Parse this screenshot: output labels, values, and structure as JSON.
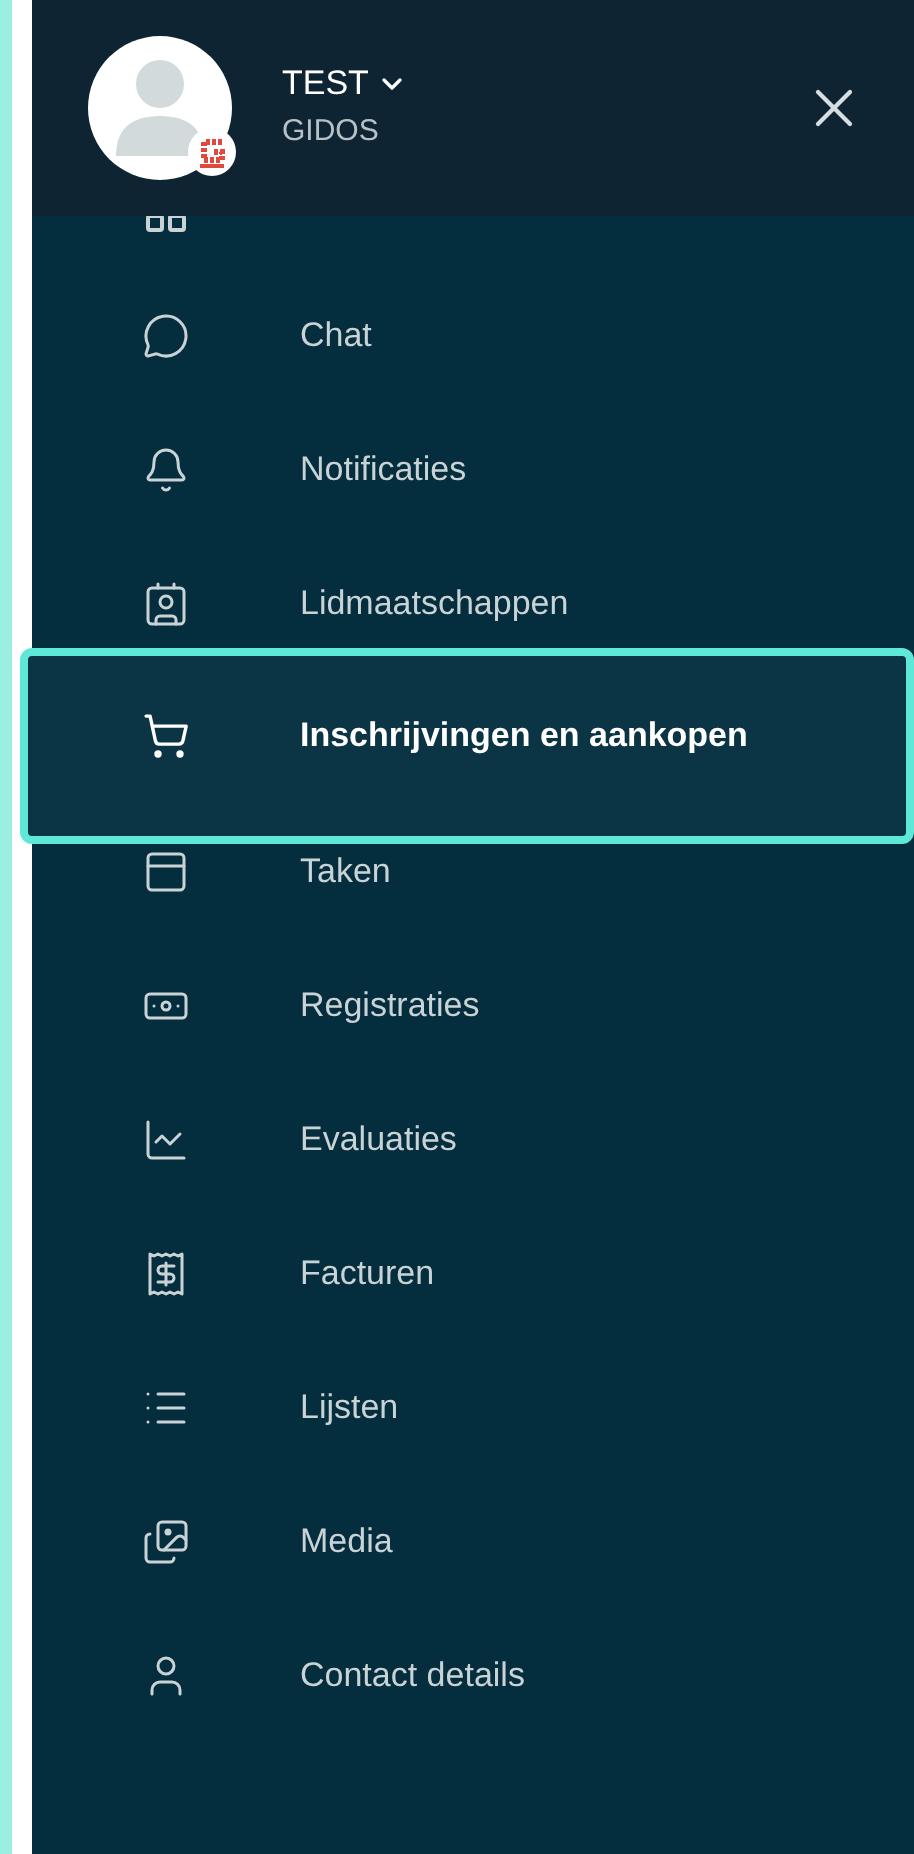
{
  "user": {
    "name": "TEST",
    "org": "GIDOS"
  },
  "menu": {
    "items": [
      {
        "label": "Chat",
        "selected": false
      },
      {
        "label": "Notificaties",
        "selected": false
      },
      {
        "label": "Lidmaatschappen",
        "selected": false
      },
      {
        "label": "Inschrijvingen en aankopen",
        "selected": true
      },
      {
        "label": "Taken",
        "selected": false
      },
      {
        "label": "Registraties",
        "selected": false
      },
      {
        "label": "Evaluaties",
        "selected": false
      },
      {
        "label": "Facturen",
        "selected": false
      },
      {
        "label": "Lijsten",
        "selected": false
      },
      {
        "label": "Media",
        "selected": false
      },
      {
        "label": "Contact details",
        "selected": false
      }
    ]
  }
}
